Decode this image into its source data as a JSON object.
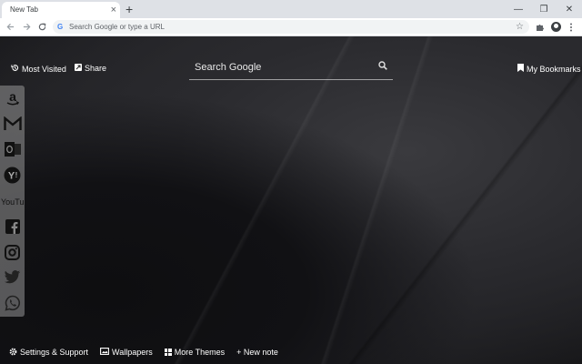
{
  "browser": {
    "tab_title": "New Tab",
    "tab_close": "×",
    "new_tab": "+",
    "window_controls": {
      "minimize": "—",
      "restore": "❐",
      "close": "✕"
    },
    "omnibox_placeholder": "Search Google or type a URL",
    "icons": [
      "back-icon",
      "forward-icon",
      "reload-icon",
      "google-icon",
      "star-icon",
      "extensions-icon",
      "profile-icon",
      "menu-icon"
    ]
  },
  "newtab": {
    "most_visited": "Most Visited",
    "share": "Share",
    "my_bookmarks": "My Bookmarks",
    "search_placeholder": "Search Google",
    "sidebar": [
      {
        "name": "amazon",
        "icon": "amazon-icon"
      },
      {
        "name": "gmail",
        "icon": "gmail-icon"
      },
      {
        "name": "outlook",
        "icon": "outlook-icon"
      },
      {
        "name": "yahoo",
        "icon": "yahoo-icon"
      },
      {
        "name": "youtube",
        "icon": "youtube-icon",
        "label": "YouTube"
      },
      {
        "name": "facebook",
        "icon": "facebook-icon"
      },
      {
        "name": "instagram",
        "icon": "instagram-icon"
      },
      {
        "name": "twitter",
        "icon": "twitter-icon"
      },
      {
        "name": "whatsapp",
        "icon": "whatsapp-icon"
      }
    ],
    "bottom": {
      "settings": "Settings & Support",
      "wallpapers": "Wallpapers",
      "more_themes": "More Themes",
      "new_note": "+ New note"
    }
  },
  "colors": {
    "tabstrip": "#dee1e6",
    "toolbar": "#ffffff",
    "omnibox": "#f1f3f4",
    "sidebar": "#969696"
  }
}
